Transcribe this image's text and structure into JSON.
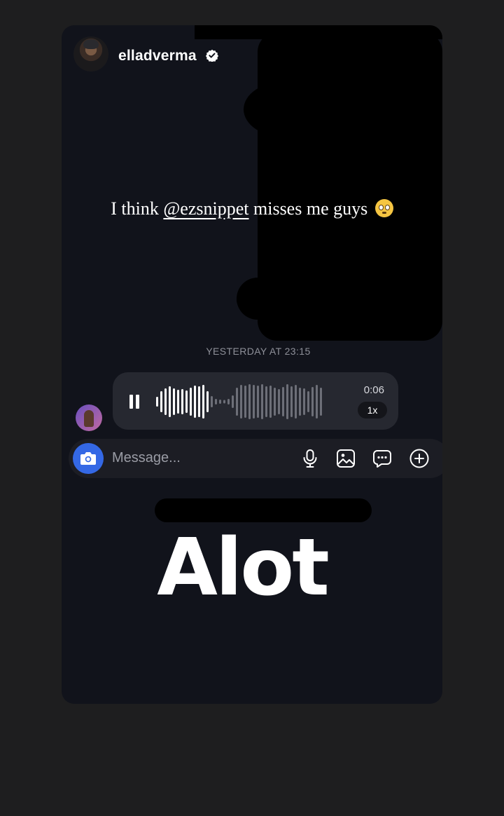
{
  "story": {
    "username": "elladverma",
    "verified": true,
    "caption_before": "I think ",
    "mention": "@ezsnippet",
    "caption_after": "  misses me guys",
    "caption_emoji": "flushed-face"
  },
  "dm": {
    "timestamp": "YESTERDAY AT 23:15",
    "voice_message": {
      "duration": "0:06",
      "speed": "1x",
      "state": "playing"
    },
    "composer": {
      "placeholder": "Message..."
    }
  },
  "overlay_text": "Alot",
  "colors": {
    "page_bg": "#1e1e1f",
    "story_bg": "#11131b",
    "bubble_bg": "#262830",
    "camera_button": "#3468e5"
  }
}
